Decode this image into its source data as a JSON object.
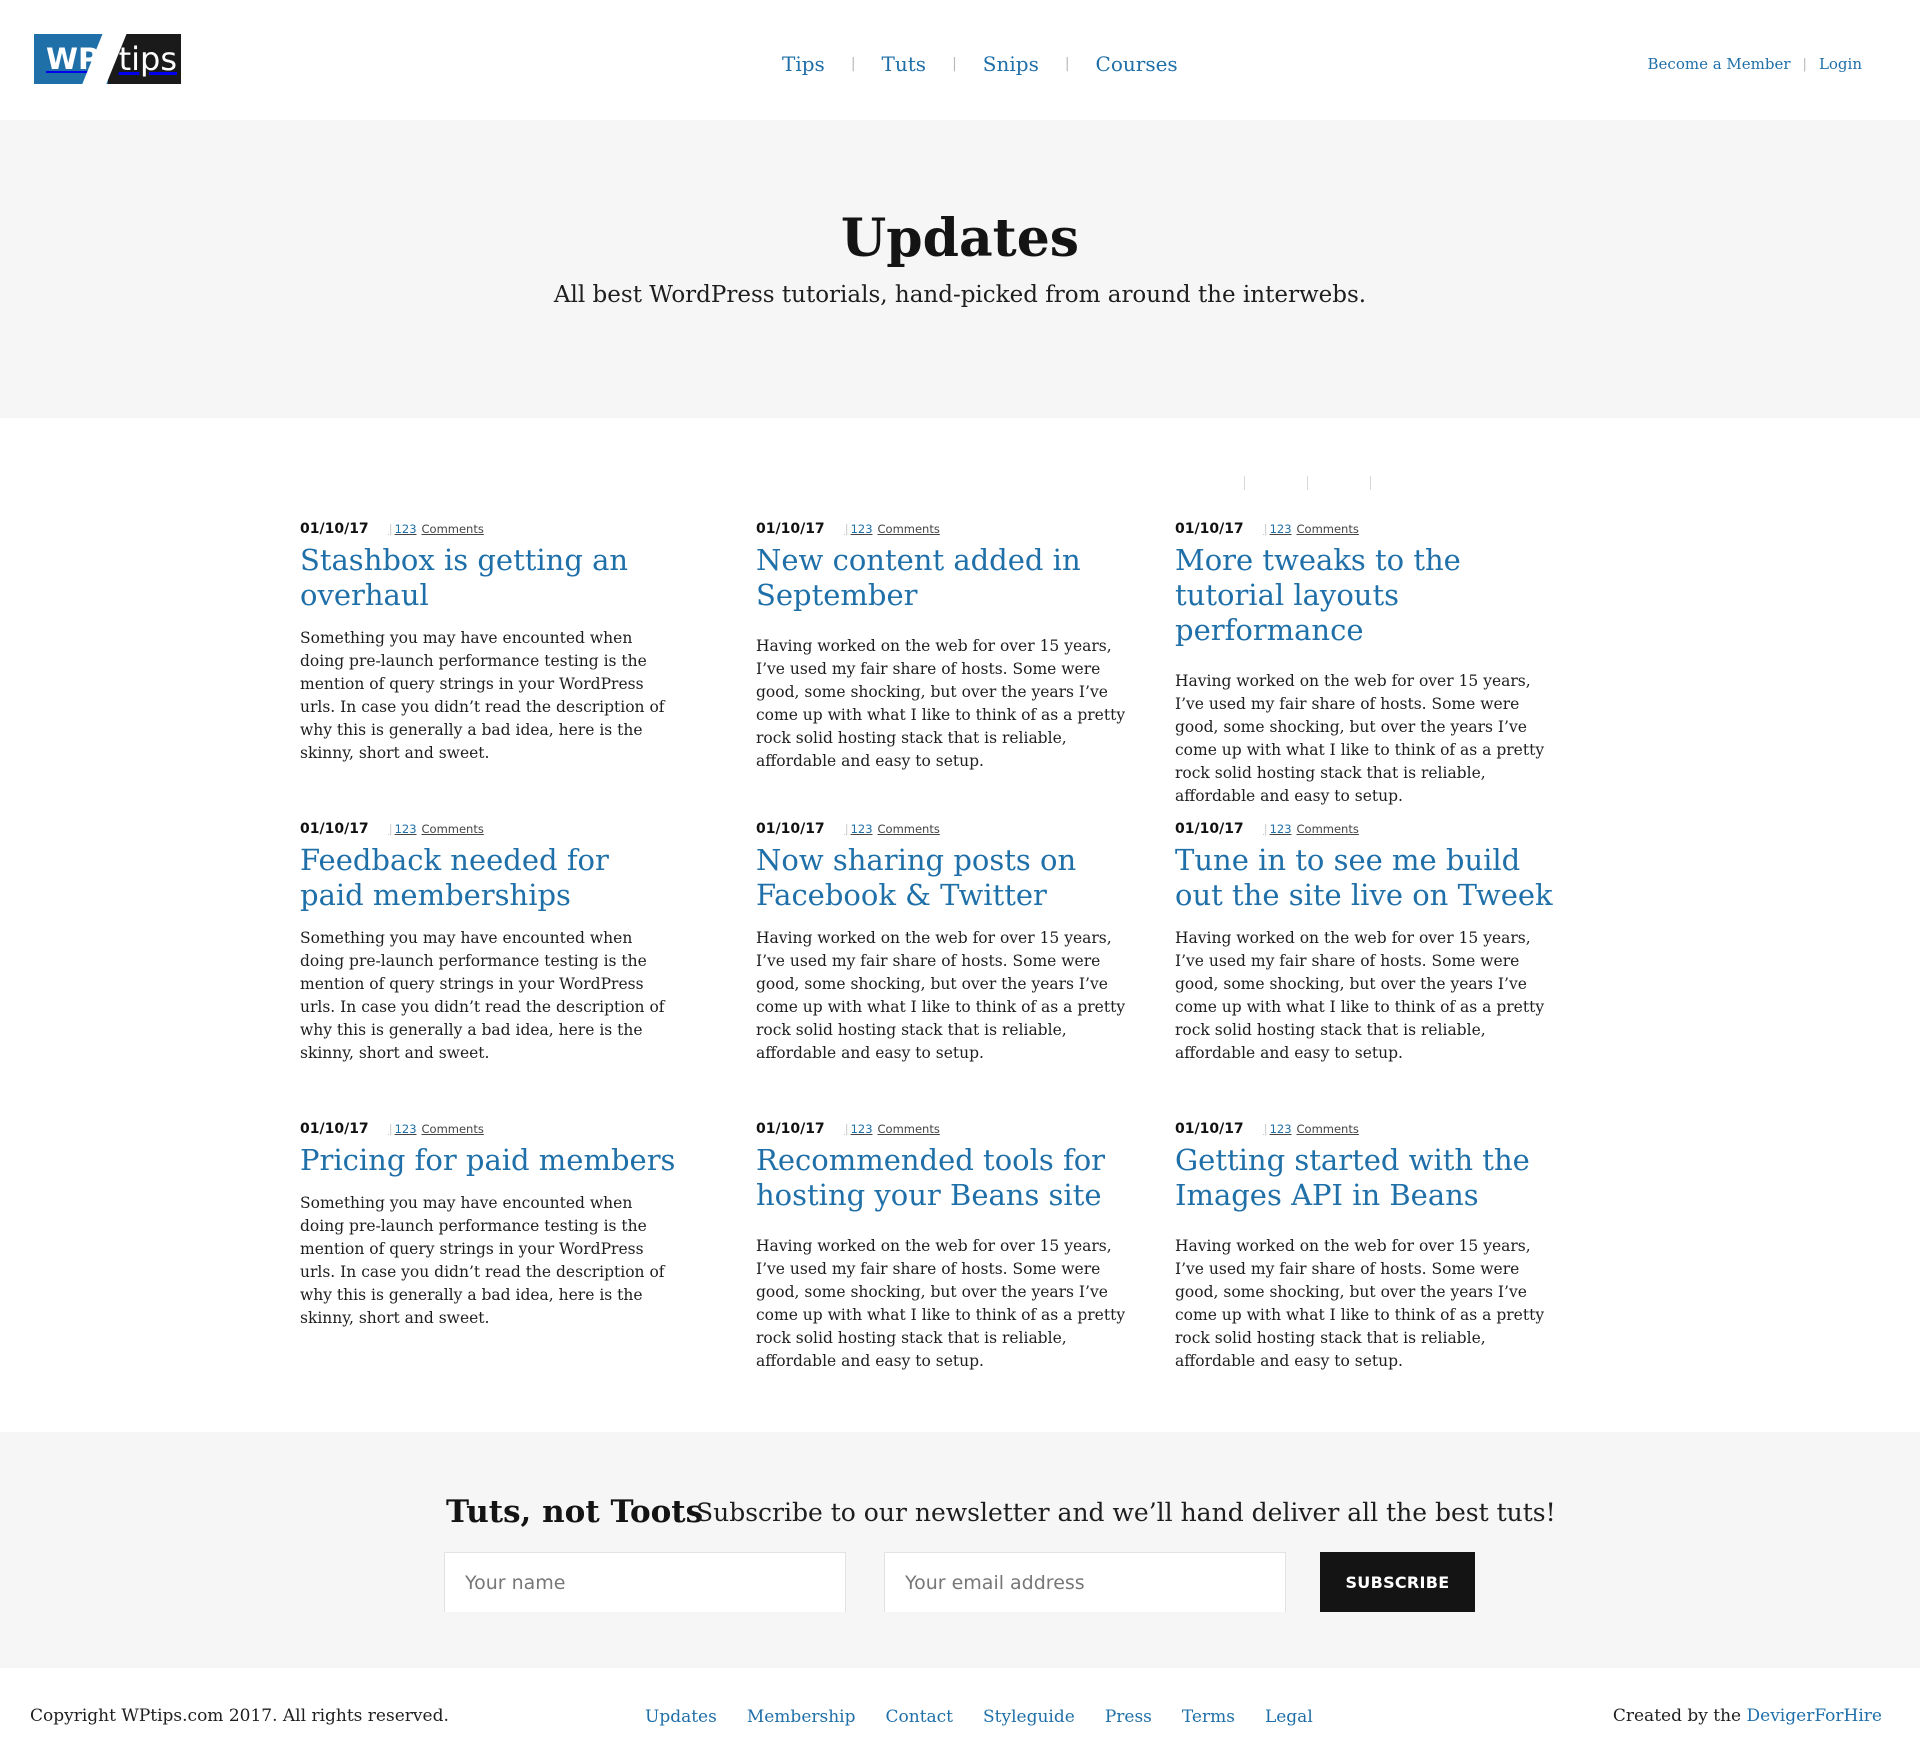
{
  "brand": {
    "logo_left": "WP",
    "logo_right": "tips"
  },
  "nav": {
    "items": [
      {
        "label": "Tips"
      },
      {
        "label": "Tuts"
      },
      {
        "label": "Snips"
      },
      {
        "label": "Courses"
      }
    ],
    "separator": "|"
  },
  "account": {
    "member_label": "Become a Member",
    "login_label": "Login"
  },
  "hero": {
    "title": "Updates",
    "subtitle": "All best WordPress tutorials, hand-picked from around the interwebs."
  },
  "posts": [
    {
      "date": "01/10/17",
      "comment_count": "123",
      "comment_label": "Comments",
      "title": "Stashbox is getting an overhaul",
      "excerpt": "Something you may have encounted when doing pre-launch performance testing is the mention of query strings in your WordPress urls. In case you didn’t read the description of why this is generally a bad idea, here is the skinny, short and sweet."
    },
    {
      "date": "01/10/17",
      "comment_count": "123",
      "comment_label": "Comments",
      "title": "New content added in September",
      "excerpt": "Having worked on the web for over 15 years, I’ve used my fair share of hosts. Some were good, some shocking, but over the years I’ve come up with what I like to think of as a pretty rock solid hosting stack that is reliable, affordable and easy to setup."
    },
    {
      "date": "01/10/17",
      "comment_count": "123",
      "comment_label": "Comments",
      "title": "More tweaks to the tutorial layouts performance",
      "excerpt": "Having worked on the web for over 15 years, I’ve used my fair share of hosts. Some were good, some shocking, but over the years I’ve come up with what I like to think of as a pretty rock solid hosting stack that is reliable, affordable and easy to setup."
    },
    {
      "date": "01/10/17",
      "comment_count": "123",
      "comment_label": "Comments",
      "title": "Feedback needed for paid memberships",
      "excerpt": "Something you may have encounted when doing pre-launch performance testing is the mention of query strings in your WordPress urls. In case you didn’t read the description of why this is generally a bad idea, here is the skinny, short and sweet."
    },
    {
      "date": "01/10/17",
      "comment_count": "123",
      "comment_label": "Comments",
      "title": "Now sharing posts on Facebook & Twitter",
      "excerpt": "Having worked on the web for over 15 years, I’ve used my fair share of hosts. Some were good, some shocking, but over the years I’ve come up with what I like to think of as a pretty rock solid hosting stack that is reliable, affordable and easy to setup."
    },
    {
      "date": "01/10/17",
      "comment_count": "123",
      "comment_label": "Comments",
      "title": "Tune in to see me build out the site live on Tweek",
      "excerpt": "Having worked on the web for over 15 years, I’ve used my fair share of hosts. Some were good, some shocking, but over the years I’ve come up with what I like to think of as a pretty rock solid hosting stack that is reliable, affordable and easy to setup."
    },
    {
      "date": "01/10/17",
      "comment_count": "123",
      "comment_label": "Comments",
      "title": "Pricing for paid members",
      "excerpt": "Something you may have encounted when doing pre-launch performance testing is the mention of query strings in your WordPress urls. In case you didn’t read the description of why this is generally a bad idea, here is the skinny, short and sweet."
    },
    {
      "date": "01/10/17",
      "comment_count": "123",
      "comment_label": "Comments",
      "title": "Recommended tools for hosting your Beans site",
      "excerpt": "Having worked on the web for over 15 years, I’ve used my fair share of hosts. Some were good, some shocking, but over the years I’ve come up with what I like to think of as a pretty rock solid hosting stack that is reliable, affordable and easy to setup."
    },
    {
      "date": "01/10/17",
      "comment_count": "123",
      "comment_label": "Comments",
      "title": "Getting started with the Images API in Beans",
      "excerpt": "Having worked on the web for over 15 years, I’ve used my fair share of hosts. Some were good, some shocking, but over the years I’ve come up with what I like to think of as a pretty rock solid hosting stack that is reliable, affordable and easy to setup."
    }
  ],
  "newsletter": {
    "heading": "Tuts, not Toots",
    "subtitle": "Subscribe to our newsletter and we’ll hand deliver all the best tuts!",
    "name_placeholder": "Your name",
    "email_placeholder": "Your email address",
    "button_label": "SUBSCRIBE"
  },
  "footer": {
    "copyright": "Copyright WPtips.com 2017. All rights reserved.",
    "links": [
      {
        "label": "Updates"
      },
      {
        "label": "Membership"
      },
      {
        "label": "Contact"
      },
      {
        "label": "Styleguide"
      },
      {
        "label": "Press"
      },
      {
        "label": "Terms"
      },
      {
        "label": "Legal"
      }
    ],
    "credit_prefix": "Created by the",
    "credit_link": "DevigerForHire"
  },
  "colors": {
    "accent": "#1f6fa8",
    "dark": "#141414",
    "panel": "#f6f6f6"
  }
}
